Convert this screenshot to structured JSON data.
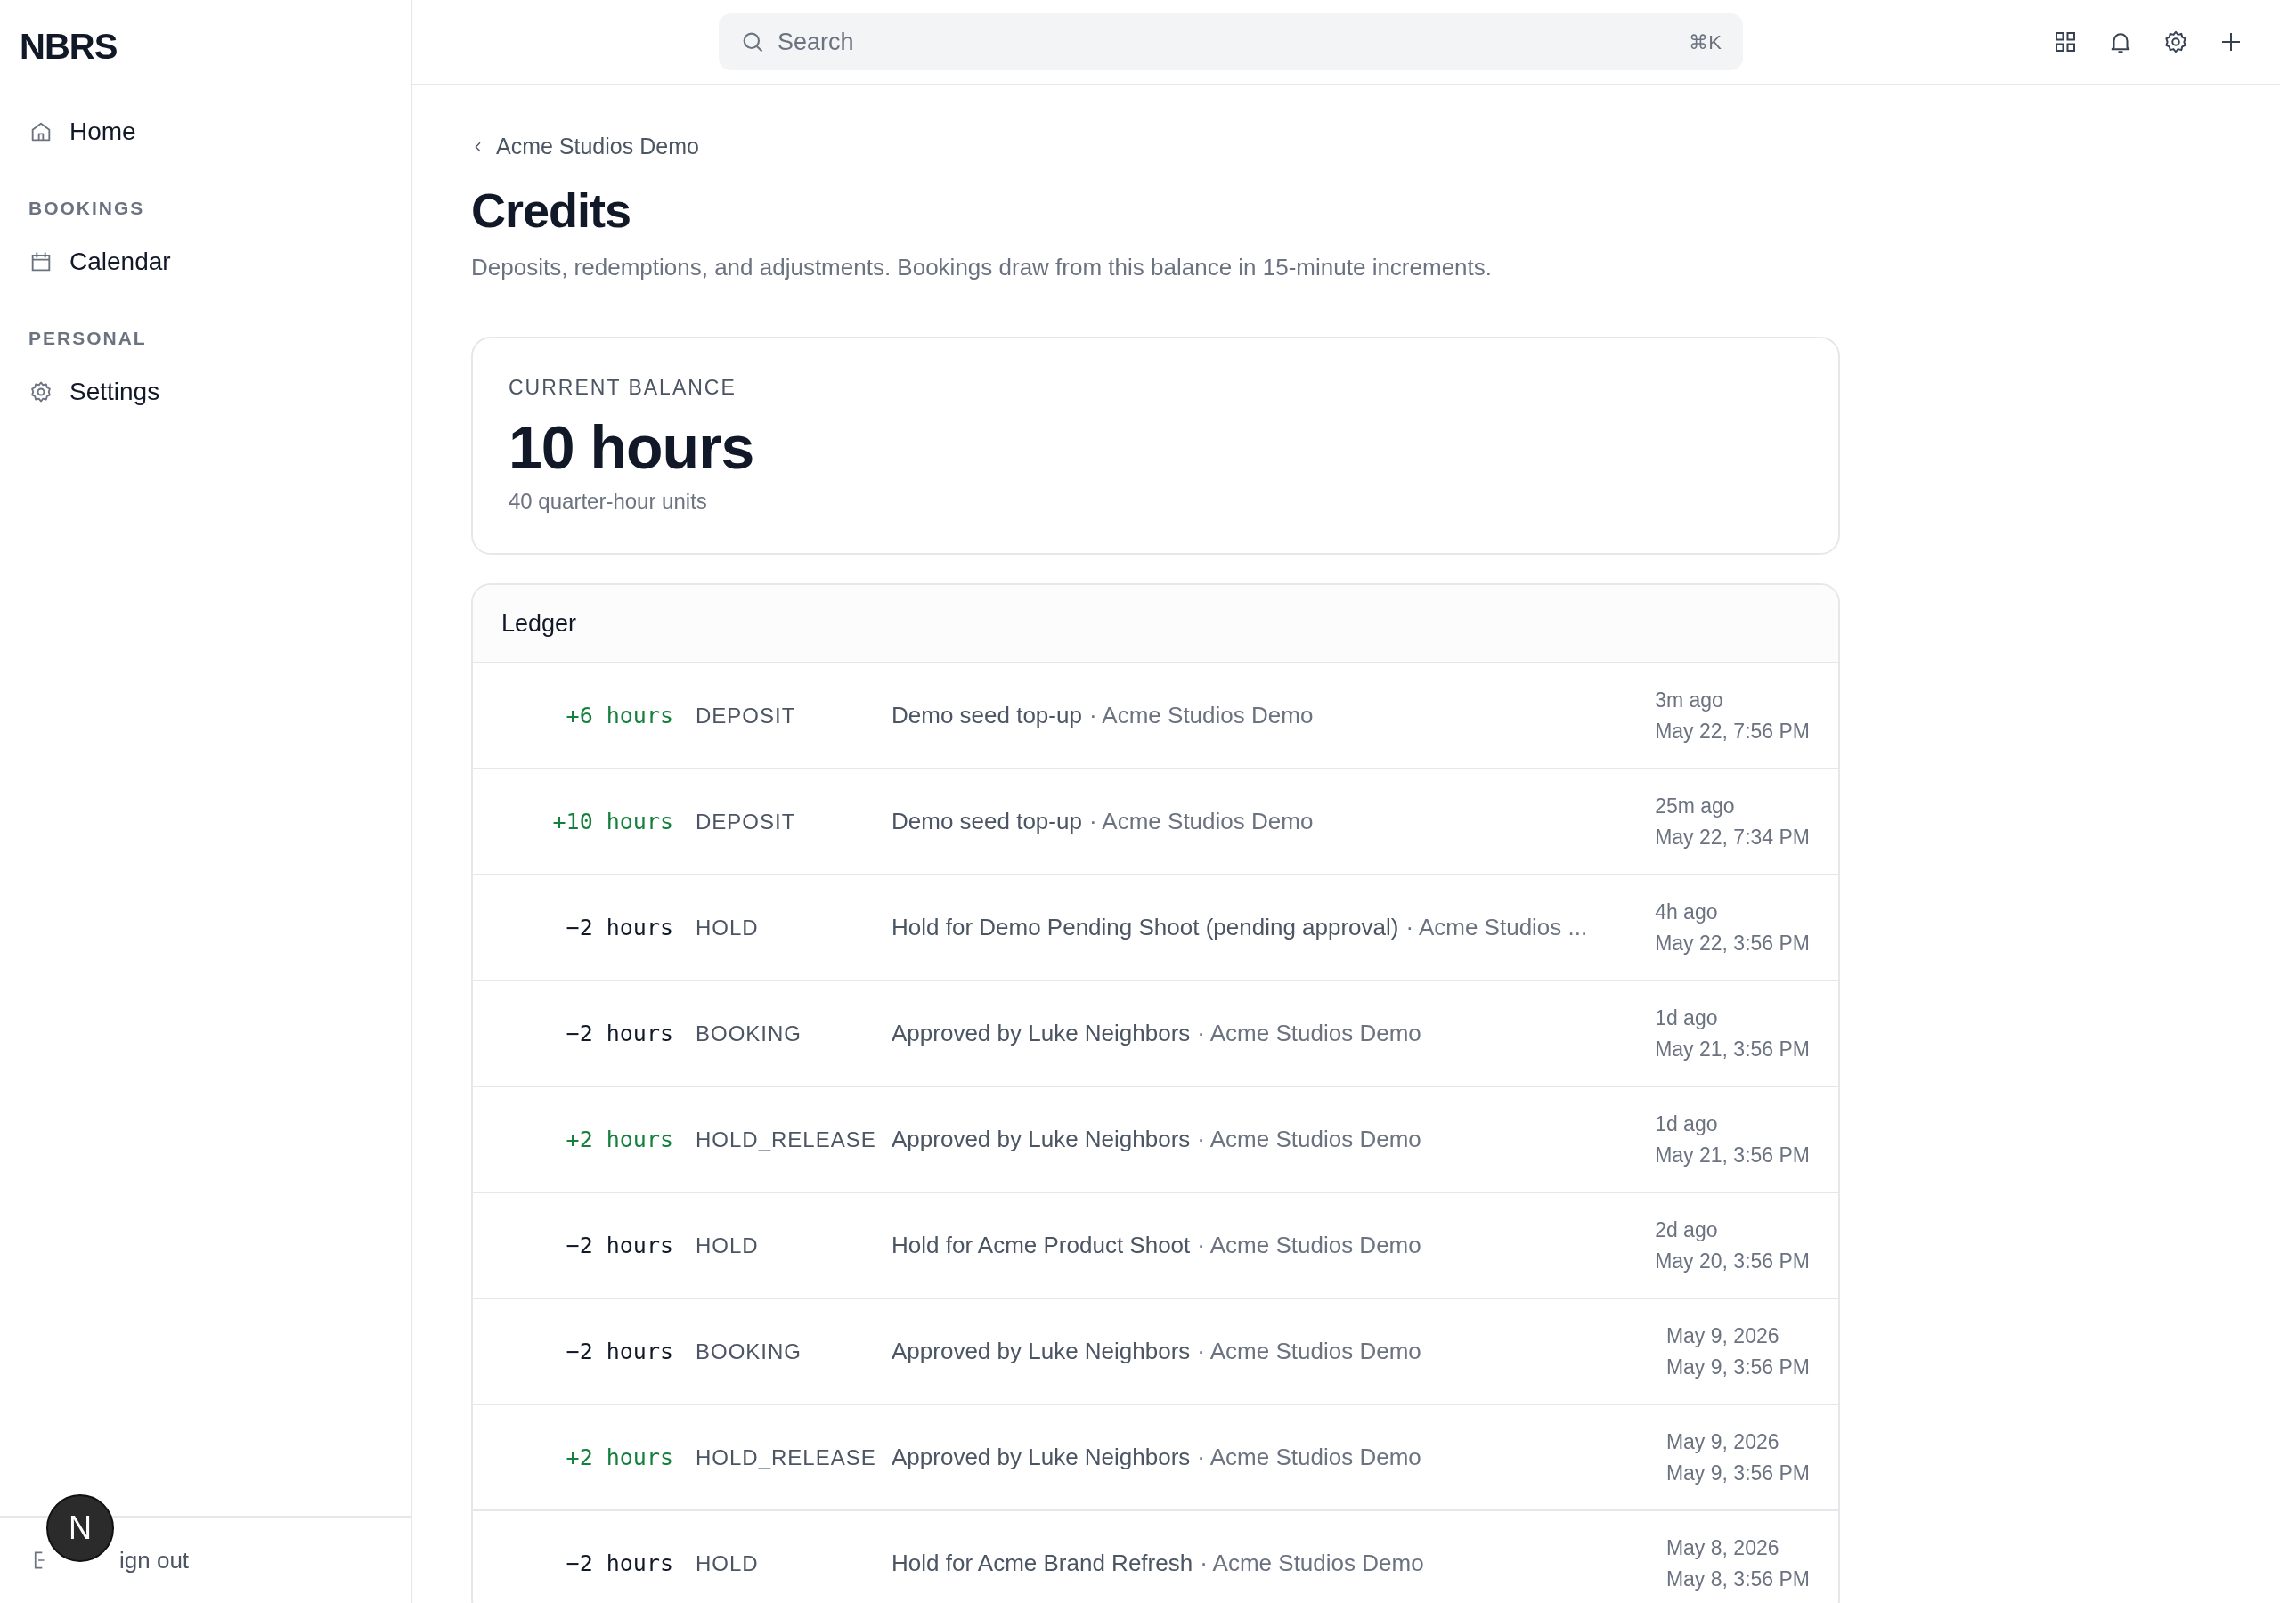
{
  "sidebar": {
    "logo": "NBRS",
    "items": [
      {
        "kind": "link",
        "label": "Home"
      },
      {
        "kind": "section",
        "label": "BOOKINGS"
      },
      {
        "kind": "link",
        "label": "Calendar"
      },
      {
        "kind": "section",
        "label": "PERSONAL"
      },
      {
        "kind": "link",
        "label": "Settings"
      }
    ],
    "sign_out": "ign out"
  },
  "topbar": {
    "search": {
      "placeholder": "Search",
      "shortcut": "⌘K"
    }
  },
  "breadcrumb": "Acme Studios Demo",
  "title": "Credits",
  "subtitle": "Deposits, redemptions, and adjustments. Bookings draw from this balance in 15-minute increments.",
  "balance": {
    "label": "CURRENT BALANCE",
    "value": "10 hours",
    "units": "40 quarter-hour units"
  },
  "ledger": {
    "title": "Ledger",
    "rows": [
      {
        "amount": "+6 hours",
        "positive": true,
        "type": "DEPOSIT",
        "description": "Demo seed top-up",
        "account": "· Acme Studios Demo",
        "when": "3m ago",
        "date": "May 22, 7:56 PM"
      },
      {
        "amount": "+10 hours",
        "positive": true,
        "type": "DEPOSIT",
        "description": "Demo seed top-up",
        "account": "· Acme Studios Demo",
        "when": "25m ago",
        "date": "May 22, 7:34 PM"
      },
      {
        "amount": "−2 hours",
        "positive": false,
        "type": "HOLD",
        "description": "Hold for Demo Pending Shoot (pending approval)",
        "account": "· Acme Studios ...",
        "when": "4h ago",
        "date": "May 22, 3:56 PM"
      },
      {
        "amount": "−2 hours",
        "positive": false,
        "type": "BOOKING",
        "description": "Approved by Luke Neighbors",
        "account": "· Acme Studios Demo",
        "when": "1d ago",
        "date": "May 21, 3:56 PM"
      },
      {
        "amount": "+2 hours",
        "positive": true,
        "type": "HOLD_RELEASE",
        "description": "Approved by Luke Neighbors",
        "account": "· Acme Studios Demo",
        "when": "1d ago",
        "date": "May 21, 3:56 PM"
      },
      {
        "amount": "−2 hours",
        "positive": false,
        "type": "HOLD",
        "description": "Hold for Acme Product Shoot",
        "account": "· Acme Studios Demo",
        "when": "2d ago",
        "date": "May 20, 3:56 PM"
      },
      {
        "amount": "−2 hours",
        "positive": false,
        "type": "BOOKING",
        "description": "Approved by Luke Neighbors",
        "account": "· Acme Studios Demo",
        "when": "May 9, 2026",
        "date": "May 9, 3:56 PM"
      },
      {
        "amount": "+2 hours",
        "positive": true,
        "type": "HOLD_RELEASE",
        "description": "Approved by Luke Neighbors",
        "account": "· Acme Studios Demo",
        "when": "May 9, 2026",
        "date": "May 9, 3:56 PM"
      },
      {
        "amount": "−2 hours",
        "positive": false,
        "type": "HOLD",
        "description": "Hold for Acme Brand Refresh",
        "account": "· Acme Studios Demo",
        "when": "May 8, 2026",
        "date": "May 8, 3:56 PM"
      }
    ]
  },
  "dev_badge": {
    "letter": "N"
  }
}
